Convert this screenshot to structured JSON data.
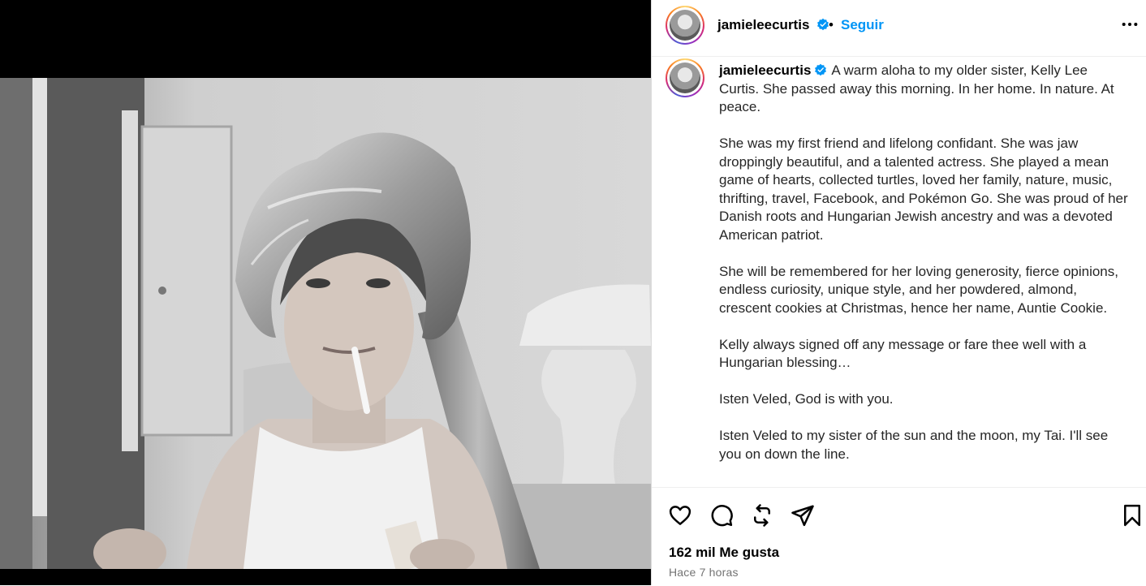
{
  "post": {
    "username": "jamieleecurtis",
    "follow_label": "Seguir",
    "separator": "•",
    "caption_paragraphs": [
      "A warm aloha to my older sister, Kelly Lee Curtis. She passed away this morning. In her home. In nature. At peace.",
      "She was my first friend and lifelong confidant. She was jaw droppingly beautiful, and a talented actress. She played a mean game of hearts, collected turtles, loved her family, nature, music, thrifting, travel, Facebook, and Pokémon Go. She was proud of her Danish roots and Hungarian Jewish ancestry and was a devoted American patriot.",
      "She will be remembered for her loving generosity, fierce opinions, endless curiosity, unique style, and her powdered, almond, crescent cookies at Christmas, hence her name, Auntie Cookie.",
      "Kelly always signed off any message or fare thee well with a Hungarian blessing…",
      "Isten Veled, God is with you.",
      "Isten Veled to my sister of the sun and the moon, my Tai. I'll see you on down the line."
    ],
    "likes": "162 mil Me gusta",
    "time": "Hace 7 horas"
  },
  "icons": {
    "verified": "verified-badge-icon",
    "more": "more-options-icon",
    "like": "heart-icon",
    "comment": "comment-icon",
    "repost": "repost-icon",
    "share": "send-icon",
    "save": "bookmark-icon"
  },
  "colors": {
    "accent": "#0095f6",
    "text": "#262626",
    "muted": "#737373",
    "media_bg": "#000000"
  }
}
